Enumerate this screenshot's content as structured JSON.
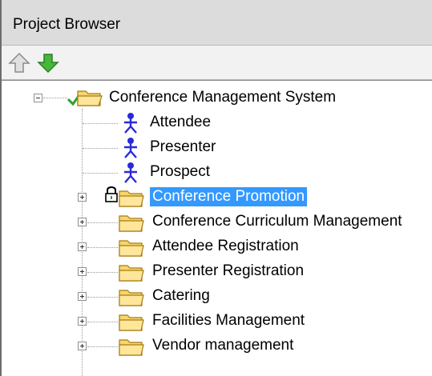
{
  "window": {
    "title": "Project Browser"
  },
  "toolbar": {
    "buttons": [
      {
        "name": "move-up",
        "icon": "arrow-up-icon",
        "color": "#d9d9d9"
      },
      {
        "name": "move-down",
        "icon": "arrow-down-icon",
        "color": "#44b83a"
      }
    ]
  },
  "tree": {
    "root": {
      "label": "Conference Management System",
      "icon": "checked-folder-icon",
      "expanded": true
    },
    "actors": [
      {
        "label": "Attendee",
        "icon": "actor-icon"
      },
      {
        "label": "Presenter",
        "icon": "actor-icon"
      },
      {
        "label": "Prospect",
        "icon": "actor-icon"
      }
    ],
    "packages": [
      {
        "label": "Conference Promotion",
        "selected": true,
        "locked": true
      },
      {
        "label": "Conference Curriculum Management",
        "selected": false
      },
      {
        "label": "Attendee Registration",
        "selected": false
      },
      {
        "label": "Presenter Registration",
        "selected": false
      },
      {
        "label": "Catering",
        "selected": false
      },
      {
        "label": "Facilities Management",
        "selected": false
      },
      {
        "label": "Vendor management",
        "selected": false
      }
    ]
  },
  "colors": {
    "selection": "#3399ff",
    "folder": "#f7d66b",
    "actor": "#2a2ad8",
    "check": "#33a02c"
  }
}
